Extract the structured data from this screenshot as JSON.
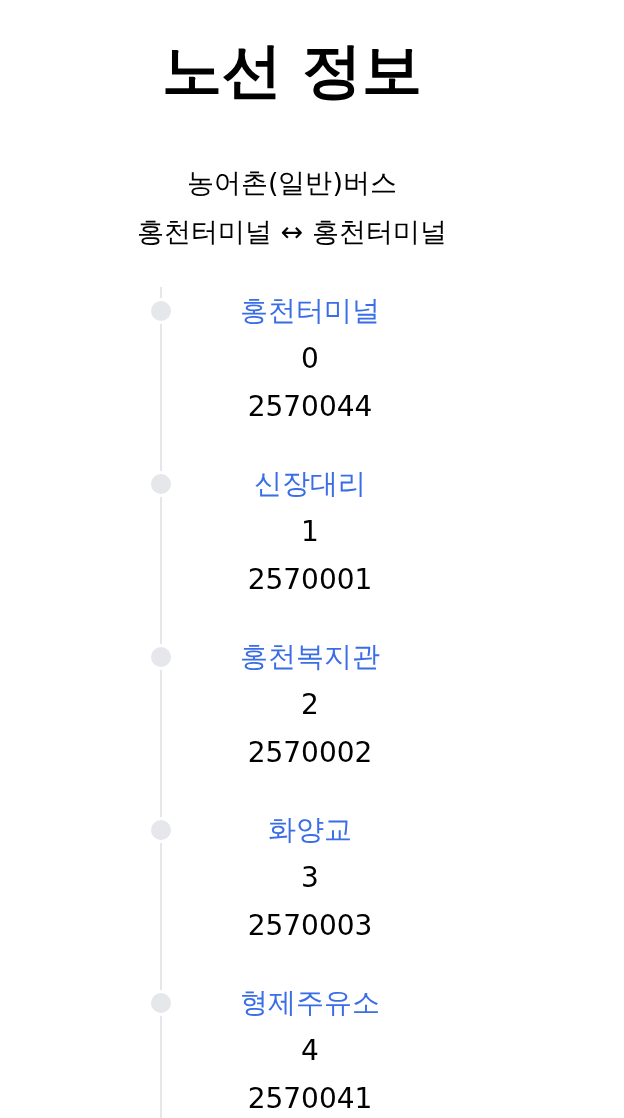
{
  "title": "노선 정보",
  "route": {
    "type": "농어촌(일반)버스",
    "endpoints": "홍천터미널 ↔ 홍천터미널"
  },
  "stops": [
    {
      "name": "홍천터미널",
      "order": "0",
      "code": "2570044"
    },
    {
      "name": "신장대리",
      "order": "1",
      "code": "2570001"
    },
    {
      "name": "홍천복지관",
      "order": "2",
      "code": "2570002"
    },
    {
      "name": "화양교",
      "order": "3",
      "code": "2570003"
    },
    {
      "name": "형제주유소",
      "order": "4",
      "code": "2570041"
    }
  ]
}
